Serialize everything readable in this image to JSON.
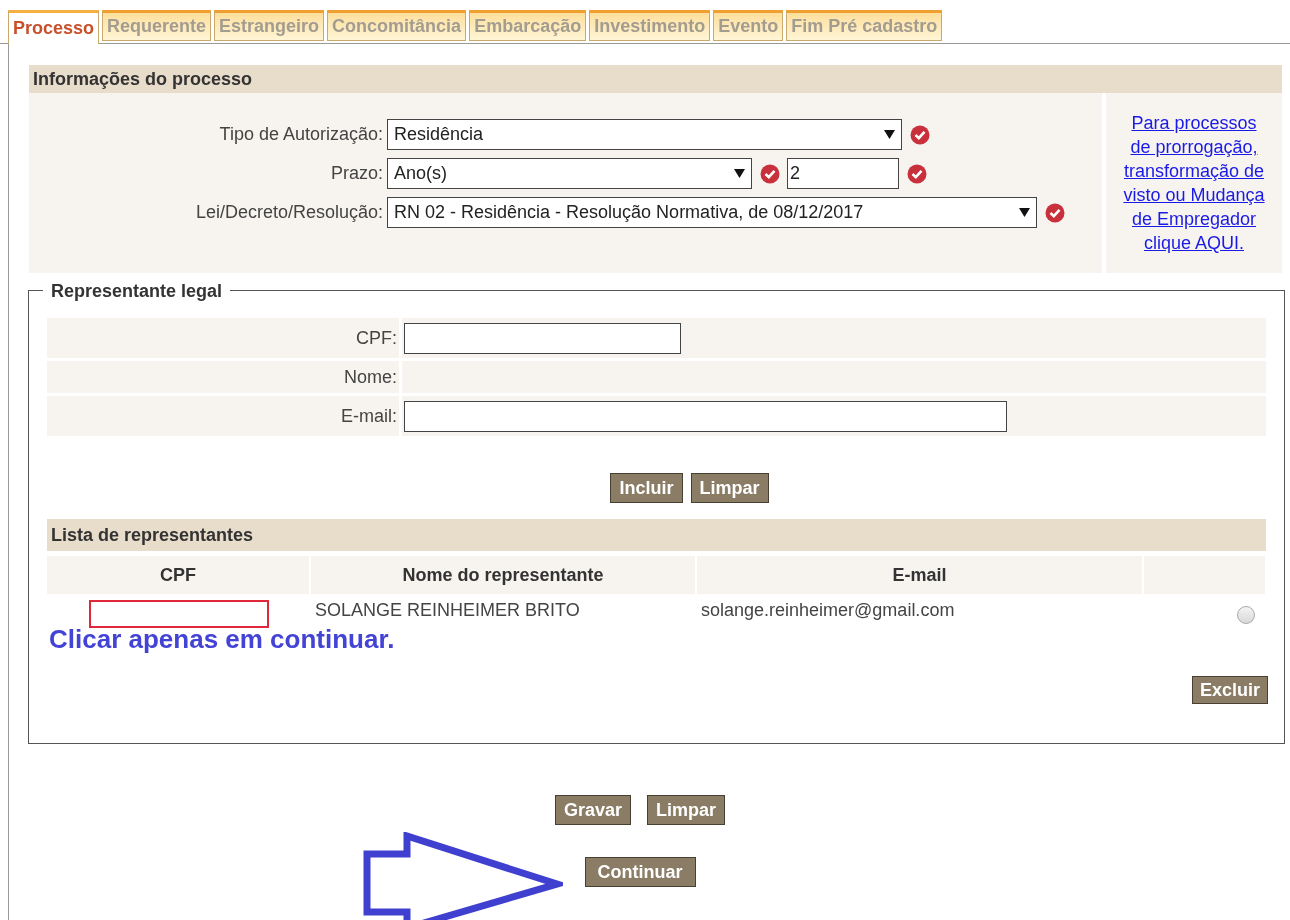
{
  "tabs": [
    {
      "label": "Processo",
      "selected": true
    },
    {
      "label": "Requerente",
      "selected": false
    },
    {
      "label": "Estrangeiro",
      "selected": false
    },
    {
      "label": "Concomitância",
      "selected": false
    },
    {
      "label": "Embarcação",
      "selected": false
    },
    {
      "label": "Investimento",
      "selected": false
    },
    {
      "label": "Evento",
      "selected": false
    },
    {
      "label": "Fim Pré cadastro",
      "selected": false
    }
  ],
  "process_info": {
    "title": "Informações do processo",
    "fields": [
      {
        "label": "Tipo de Autorização:",
        "controls": [
          {
            "kind": "select",
            "value": "Residência",
            "required": true
          }
        ]
      },
      {
        "label": "Prazo:",
        "controls": [
          {
            "kind": "select",
            "value": "Ano(s)",
            "required": true
          },
          {
            "kind": "text",
            "value": "2",
            "required": true
          }
        ]
      },
      {
        "label": "Lei/Decreto/Resolução:",
        "controls": [
          {
            "kind": "select",
            "value": "RN 02 - Residência - Resolução Normativa, de 08/12/2017",
            "required": true
          }
        ]
      }
    ],
    "side_link": "Para processos de prorrogação, transformação de visto ou Mudança de Empregador clique AQUI."
  },
  "legal_representative": {
    "legend": "Representante legal",
    "fields": [
      {
        "label": "CPF:",
        "kind": "input"
      },
      {
        "label": "Nome:",
        "kind": "readonly"
      },
      {
        "label": "E-mail:",
        "kind": "input"
      }
    ],
    "buttons": [
      "Incluir",
      "Limpar"
    ],
    "list_title": "Lista de representantes",
    "columns": [
      "CPF",
      "Nome do representante",
      "E-mail"
    ],
    "rows": [
      {
        "name": "SOLANGE REINHEIMER BRITO",
        "email": "solange.reinheimer@gmail.com",
        "selected": false
      }
    ],
    "note": "Clicar apenas em continuar.",
    "delete_button": "Excluir"
  },
  "bottom_buttons": [
    "Gravar",
    "Limpar"
  ],
  "continue_button": "Continuar"
}
